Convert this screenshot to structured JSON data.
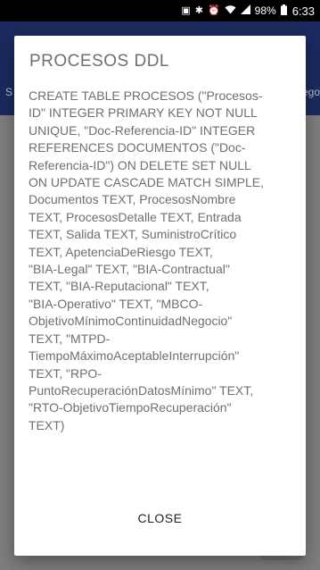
{
  "status_bar": {
    "battery_percent": "98%",
    "time": "6:33",
    "icons": [
      "photo-icon",
      "bluetooth-icon",
      "alarm-icon",
      "wifi-icon",
      "signal-icon",
      "battery-icon"
    ]
  },
  "background": {
    "left_hint": "S",
    "right_hint": "iego"
  },
  "dialog": {
    "title": "PROCESOS DDL",
    "body_lines": [
      "CREATE TABLE PROCESOS (\"Procesos-",
      "ID\" INTEGER PRIMARY KEY NOT NULL",
      "UNIQUE, \"Doc-Referencia-ID\" INTEGER",
      "REFERENCES DOCUMENTOS (\"Doc-",
      "Referencia-ID\") ON DELETE SET NULL",
      "ON UPDATE CASCADE MATCH SIMPLE,",
      "Documentos TEXT, ProcesosNombre",
      "TEXT, ProcesosDetalle TEXT, Entrada",
      "TEXT, Salida TEXT, SuministroCrítico",
      "TEXT, ApetenciaDeRiesgo TEXT,",
      "\"BIA-Legal\" TEXT, \"BIA-Contractual\"",
      "TEXT, \"BIA-Reputacional\" TEXT,",
      "\"BIA-Operativo\" TEXT, \"MBCO-",
      "ObjetivoMínimoContinuidadNegocio\"",
      "TEXT, \"MTPD-",
      "TiempoMáximoAceptableInterrupción\"",
      "TEXT, \"RPO-",
      "PuntoRecuperaciónDatosMínimo\" TEXT,",
      "\"RTO-ObjetivoTiempoRecuperación\"",
      "TEXT)"
    ],
    "close_label": "CLOSE"
  },
  "colors": {
    "app_bar": "#1b2a5e",
    "scrim": "#7d7d7d",
    "dialog_text": "#6f6f6f",
    "button_text": "#222222"
  }
}
